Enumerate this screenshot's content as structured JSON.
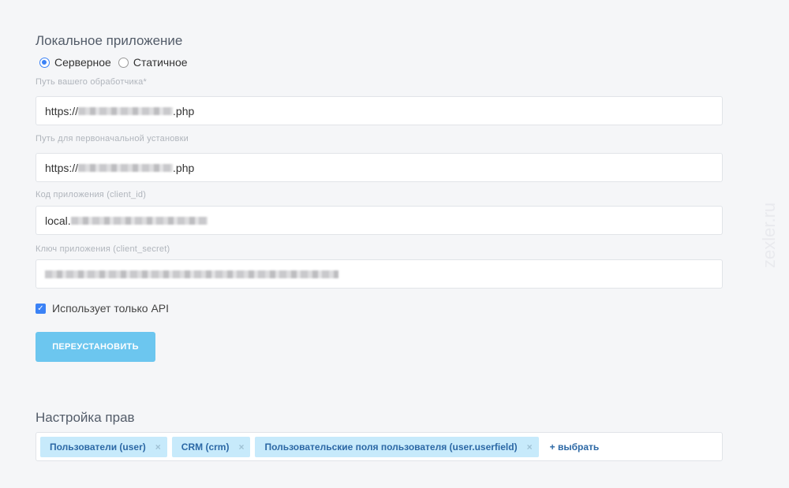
{
  "section_title": "Локальное приложение",
  "app_type": {
    "options": [
      "Серверное",
      "Статичное"
    ],
    "selected": "Серверное"
  },
  "fields": [
    {
      "label": "Путь вашего обработчика*",
      "prefix": "https://",
      "suffix": ".php"
    },
    {
      "label": "Путь для первоначальной установки",
      "prefix": "https://",
      "suffix": ".php"
    },
    {
      "label": "Код приложения (client_id)",
      "prefix": "local.",
      "suffix": ""
    },
    {
      "label": "Ключ приложения (client_secret)",
      "prefix": "",
      "suffix": ""
    }
  ],
  "api_only": {
    "label": "Использует только API",
    "checked": true
  },
  "reinstall_button": "ПЕРЕУСТАНОВИТЬ",
  "rights": {
    "title": "Настройка прав",
    "tags": [
      "Пользователи (user)",
      "CRM (crm)",
      "Пользовательские поля пользователя (user.userfield)"
    ],
    "remove": "×",
    "add_label": "+ выбрать"
  },
  "watermark": "zexler.ru",
  "colors": {
    "accent": "#3b82f6",
    "button": "#6cc6ef",
    "tag_bg": "#c7eafb",
    "tag_text": "#2c68a5"
  }
}
